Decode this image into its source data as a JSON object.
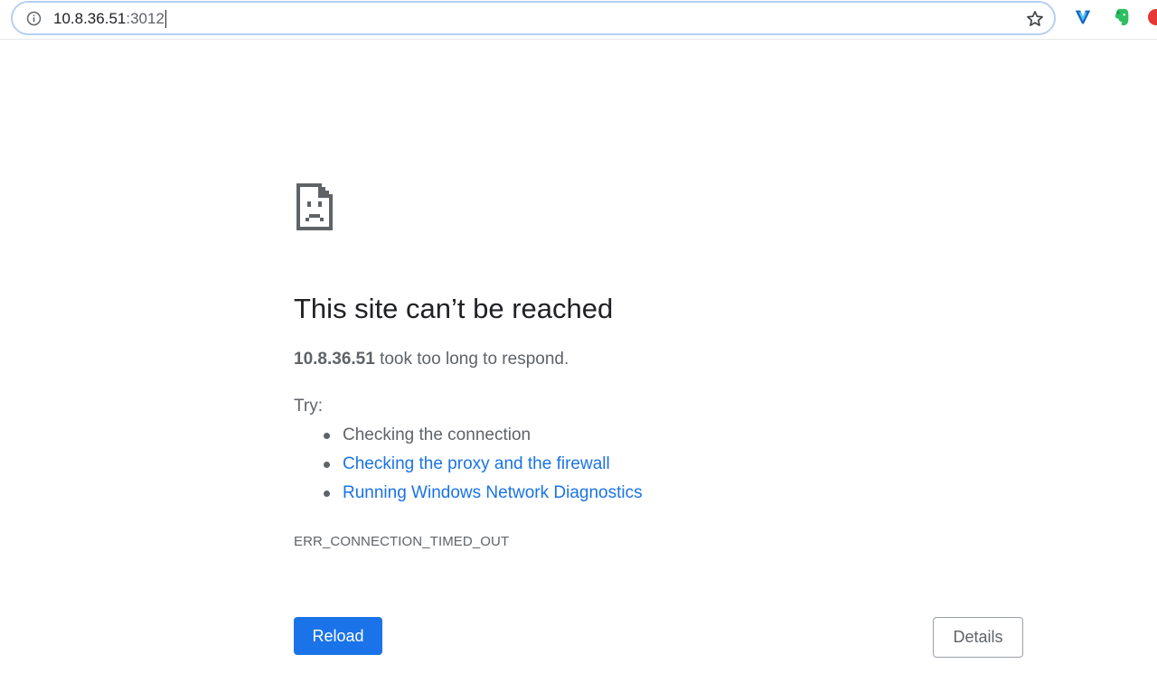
{
  "toolbar": {
    "url_host": "10.8.36.51",
    "url_port": ":3012",
    "icons": [
      "info-icon",
      "star-icon",
      "vpn-extension-icon",
      "evernote-extension-icon",
      "red-extension-icon"
    ]
  },
  "error_page": {
    "icon": "sad-document-icon",
    "heading": "This site can’t be reached",
    "summary_host": "10.8.36.51",
    "summary_text": " took too long to respond.",
    "try_label": "Try:",
    "suggestions": [
      {
        "label": "Checking the connection",
        "is_link": false
      },
      {
        "label": "Checking the proxy and the firewall",
        "is_link": true
      },
      {
        "label": "Running Windows Network Diagnostics",
        "is_link": true
      }
    ],
    "error_code": "ERR_CONNECTION_TIMED_OUT",
    "reload_label": "Reload",
    "details_label": "Details"
  },
  "colors": {
    "accent": "#1a73e8",
    "text_primary": "#202124",
    "text_secondary": "#5f6368",
    "omnibox_border": "#b6cff2"
  }
}
